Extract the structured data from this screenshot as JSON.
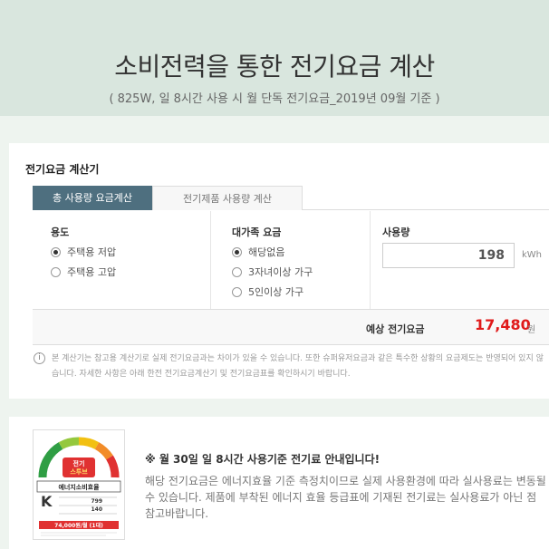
{
  "hero": {
    "title": "소비전력을 통한 전기요금 계산",
    "subtitle": "( 825W, 일 8시간 사용 시 월 단독 전기요금_2019년 09월 기준 )"
  },
  "calculator": {
    "title": "전기요금 계산기",
    "tabs": [
      {
        "label": "총 사용량 요금계산",
        "active": true
      },
      {
        "label": "전기제품 사용량 계산",
        "active": false
      }
    ],
    "purpose": {
      "label": "용도",
      "options": [
        {
          "label": "주택용 저압",
          "selected": true
        },
        {
          "label": "주택용 고압",
          "selected": false
        }
      ]
    },
    "family": {
      "label": "대가족 요금",
      "options": [
        {
          "label": "해당없음",
          "selected": true
        },
        {
          "label": "3자녀이상 가구",
          "selected": false
        },
        {
          "label": "5인이상 가구",
          "selected": false
        }
      ]
    },
    "usage": {
      "label": "사용량",
      "value": "198",
      "unit": "kWh"
    },
    "result": {
      "label": "예상 전기요금",
      "value": "17,480",
      "unit": "원"
    },
    "note": "본 계산기는 참고용 계산기로 실제 전기요금과는 차이가 있을 수 있습니다. 또한 슈퍼유저요금과 같은 특수한 상황의 요금제도는 반영되어 있지 않습니다. 자세한 사항은 아래 한전 전기요금계산기 및 전기요금표를 확인하시기 바랍니다."
  },
  "info": {
    "title": "※ 월 30일 일 8시간 사용기준 전기료 안내입니다!",
    "body": "해당 전기요금은 에너지효율 기준 측정치이므로 실제 사용환경에 따라 실사용료는 변동될 수 있습니다.  제품에 부착된 에너지 효율 등급표에 기재된 전기료는 실사용료가 아닌 점 참고바랍니다.",
    "energy_label": {
      "header": "전기 스투브",
      "title": "에너지소비효율",
      "values": [
        "799",
        "140"
      ],
      "price": "74,000원/월 (1대)"
    }
  },
  "colors": {
    "accent_tab": "#4e6f7f",
    "result_red": "#e01a1a",
    "hero_bg": "#d9e6de",
    "page_bg": "#eef4ef"
  }
}
